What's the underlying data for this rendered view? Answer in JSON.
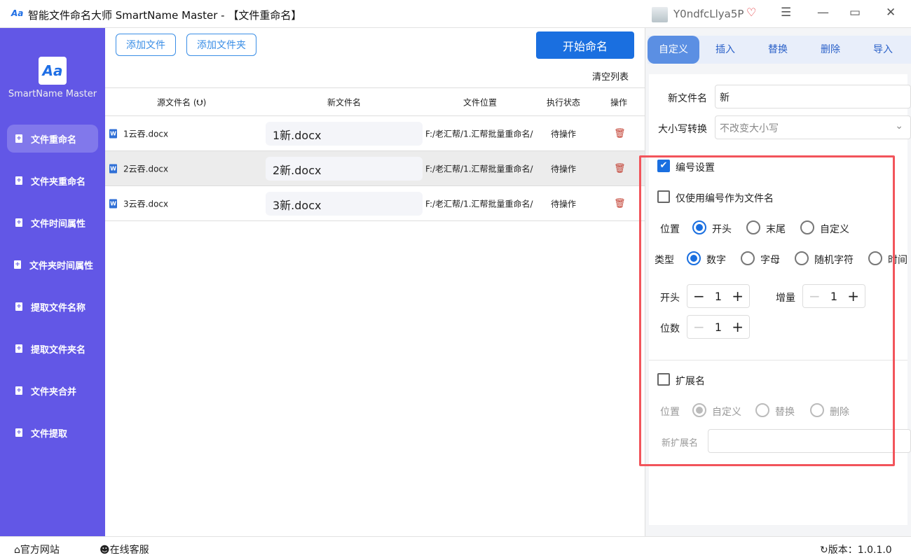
{
  "window": {
    "title": "智能文件命名大师 SmartName Master - 【文件重命名】",
    "username": "Y0ndfcLlya5P",
    "menu_icon": "hamburger-icon",
    "minimize": "—",
    "maximize": "▭",
    "close": "✕"
  },
  "sidebar": {
    "app_name": "SmartName Master",
    "items": [
      {
        "label": "文件重命名"
      },
      {
        "label": "文件夹重命名"
      },
      {
        "label": "文件时间属性"
      },
      {
        "label": "文件夹时间属性"
      },
      {
        "label": "提取文件名称"
      },
      {
        "label": "提取文件夹名"
      },
      {
        "label": "文件夹合并"
      },
      {
        "label": "文件提取"
      }
    ]
  },
  "toolbar": {
    "add_file": "添加文件",
    "add_folder": "添加文件夹",
    "start": "开始命名",
    "clear": "清空列表"
  },
  "table": {
    "headers": [
      "源文件名 (⮋)",
      "新文件名",
      "文件位置",
      "执行状态",
      "操作"
    ],
    "rows": [
      {
        "source": "1云吞.docx",
        "new": "1新.docx",
        "location": "F:/老汇帮/1.汇帮批量重命名/",
        "status": "待操作"
      },
      {
        "source": "2云吞.docx",
        "new": "2新.docx",
        "location": "F:/老汇帮/1.汇帮批量重命名/",
        "status": "待操作"
      },
      {
        "source": "3云吞.docx",
        "new": "3新.docx",
        "location": "F:/老汇帮/1.汇帮批量重命名/",
        "status": "待操作"
      }
    ]
  },
  "panel": {
    "tabs": [
      "自定义",
      "插入",
      "替换",
      "删除",
      "导入"
    ],
    "new_name_label": "新文件名",
    "new_name_value": "新",
    "case_label": "大小写转换",
    "case_value": "不改变大小写",
    "numbering_label": "编号设置",
    "numbering_checked": true,
    "only_number_label": "仅使用编号作为文件名",
    "only_number_checked": false,
    "position_label": "位置",
    "position_options": [
      "开头",
      "末尾",
      "自定义"
    ],
    "position_selected": "开头",
    "type_label": "类型",
    "type_options": [
      "数字",
      "字母",
      "随机字符",
      "时间"
    ],
    "type_selected": "数字",
    "start_label": "开头",
    "start_value": "1",
    "increment_label": "增量",
    "increment_value": "1",
    "digits_label": "位数",
    "digits_value": "1",
    "ext_label": "扩展名",
    "ext_checked": false,
    "ext_position_label": "位置",
    "ext_options": [
      "自定义",
      "替换",
      "删除"
    ],
    "ext_selected": "自定义",
    "new_ext_label": "新扩展名",
    "new_ext_value": ""
  },
  "bottom": {
    "website": "官方网站",
    "support": "在线客服",
    "version": "版本：1.0.1.0"
  }
}
